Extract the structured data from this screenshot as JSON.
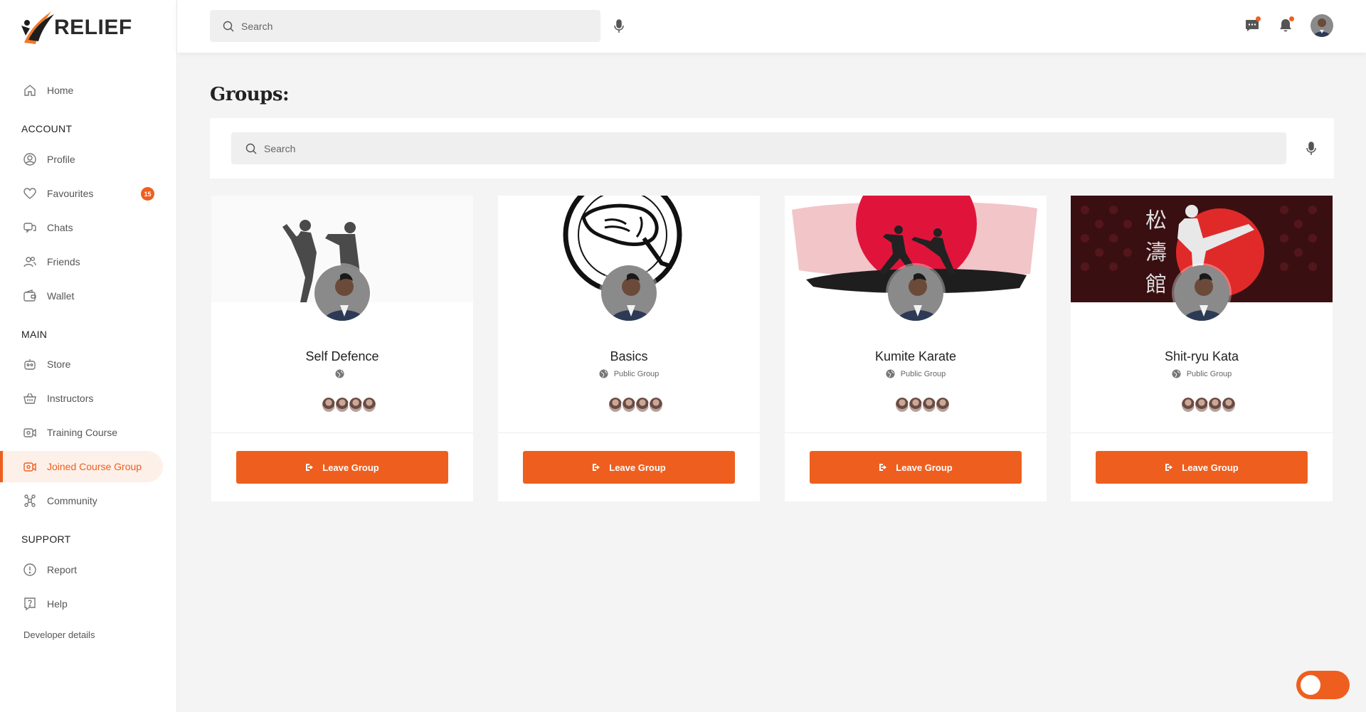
{
  "brand": {
    "name": "RELIEF",
    "accent": "#ee5f1f"
  },
  "header": {
    "search_placeholder": "Search"
  },
  "sidebar": {
    "home": "Home",
    "sections": {
      "account": "ACCOUNT",
      "main": "MAIN",
      "support": "SUPPORT"
    },
    "account_items": [
      {
        "label": "Profile",
        "icon": "user-circle-icon"
      },
      {
        "label": "Favourites",
        "icon": "heart-icon",
        "badge": "15"
      },
      {
        "label": "Chats",
        "icon": "chat-icon"
      },
      {
        "label": "Friends",
        "icon": "users-icon"
      },
      {
        "label": "Wallet",
        "icon": "wallet-icon"
      }
    ],
    "main_items": [
      {
        "label": "Store",
        "icon": "store-icon"
      },
      {
        "label": "Instructors",
        "icon": "basket-icon"
      },
      {
        "label": "Training Course",
        "icon": "video-icon"
      },
      {
        "label": "Joined Course Group",
        "icon": "video-group-icon",
        "active": true
      },
      {
        "label": "Community",
        "icon": "community-icon"
      }
    ],
    "support_items": [
      {
        "label": "Report",
        "icon": "alert-icon"
      },
      {
        "label": "Help",
        "icon": "help-icon"
      }
    ],
    "developer_link": "Developer details"
  },
  "page": {
    "title": "Groups:",
    "search_placeholder": "Search"
  },
  "groups": [
    {
      "name": "Self Defence",
      "type": "",
      "button": "Leave Group"
    },
    {
      "name": "Basics",
      "type": "Public Group",
      "button": "Leave Group"
    },
    {
      "name": "Kumite Karate",
      "type": "Public Group",
      "button": "Leave Group"
    },
    {
      "name": "Shit-ryu Kata",
      "type": "Public Group",
      "button": "Leave Group"
    }
  ]
}
